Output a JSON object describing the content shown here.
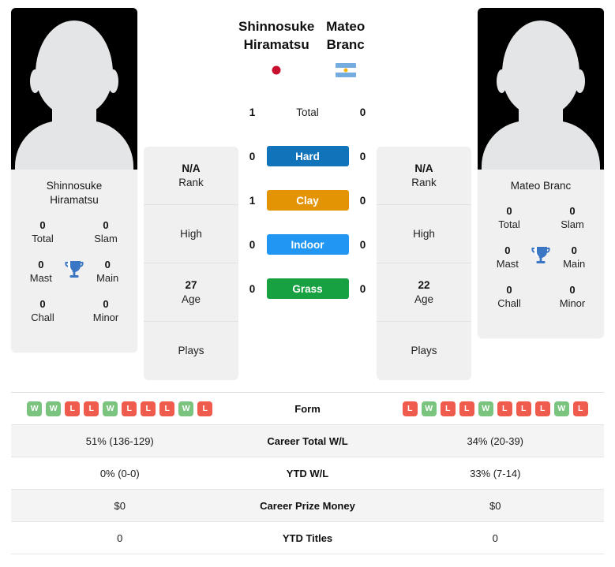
{
  "players": {
    "left": {
      "hero_name": "Shinnosuke\nHiramatsu",
      "card_name": "Shinnosuke\nHiramatsu",
      "flag": "jp-flag-icon",
      "titles": {
        "total_val": "0",
        "total_lbl": "Total",
        "slam_val": "0",
        "slam_lbl": "Slam",
        "mast_val": "0",
        "mast_lbl": "Mast",
        "main_val": "0",
        "main_lbl": "Main",
        "chall_val": "0",
        "chall_lbl": "Chall",
        "minor_val": "0",
        "minor_lbl": "Minor"
      },
      "info": {
        "rank_val": "N/A",
        "rank_lbl": "Rank",
        "high_val": "",
        "high_lbl": "High",
        "age_val": "27",
        "age_lbl": "Age",
        "plays_val": "",
        "plays_lbl": "Plays"
      },
      "surface_counts": {
        "total": "1",
        "hard": "0",
        "clay": "1",
        "indoor": "0",
        "grass": "0"
      },
      "form": [
        "W",
        "W",
        "L",
        "L",
        "W",
        "L",
        "L",
        "L",
        "W",
        "L"
      ],
      "career_total_wl": "51% (136-129)",
      "ytd_wl": "0% (0-0)",
      "career_prize_money": "$0",
      "ytd_titles": "0"
    },
    "right": {
      "hero_name": "Mateo Branc",
      "card_name": "Mateo Branc",
      "flag": "ar-flag-icon",
      "titles": {
        "total_val": "0",
        "total_lbl": "Total",
        "slam_val": "0",
        "slam_lbl": "Slam",
        "mast_val": "0",
        "mast_lbl": "Mast",
        "main_val": "0",
        "main_lbl": "Main",
        "chall_val": "0",
        "chall_lbl": "Chall",
        "minor_val": "0",
        "minor_lbl": "Minor"
      },
      "info": {
        "rank_val": "N/A",
        "rank_lbl": "Rank",
        "high_val": "",
        "high_lbl": "High",
        "age_val": "22",
        "age_lbl": "Age",
        "plays_val": "",
        "plays_lbl": "Plays"
      },
      "surface_counts": {
        "total": "0",
        "hard": "0",
        "clay": "0",
        "indoor": "0",
        "grass": "0"
      },
      "form": [
        "L",
        "W",
        "L",
        "L",
        "W",
        "L",
        "L",
        "L",
        "W",
        "L"
      ],
      "career_total_wl": "34% (20-39)",
      "ytd_wl": "33% (7-14)",
      "career_prize_money": "$0",
      "ytd_titles": "0"
    }
  },
  "surfaces": [
    {
      "key": "total",
      "label": "Total",
      "color": "transparent"
    },
    {
      "key": "hard",
      "label": "Hard",
      "color": "#1173ba"
    },
    {
      "key": "clay",
      "label": "Clay",
      "color": "#e39405"
    },
    {
      "key": "indoor",
      "label": "Indoor",
      "color": "#2196f3"
    },
    {
      "key": "grass",
      "label": "Grass",
      "color": "#17a141"
    }
  ],
  "table_labels": {
    "form": "Form",
    "career_total_wl": "Career Total W/L",
    "ytd_wl": "YTD W/L",
    "career_prize_money": "Career Prize Money",
    "ytd_titles": "YTD Titles"
  },
  "colors": {
    "win_badge": "#7ac47f",
    "loss_badge": "#ef5b4c",
    "trophy": "#3a76c4",
    "card_bg": "#f0f0f0",
    "row_alt": "#f4f4f4"
  }
}
